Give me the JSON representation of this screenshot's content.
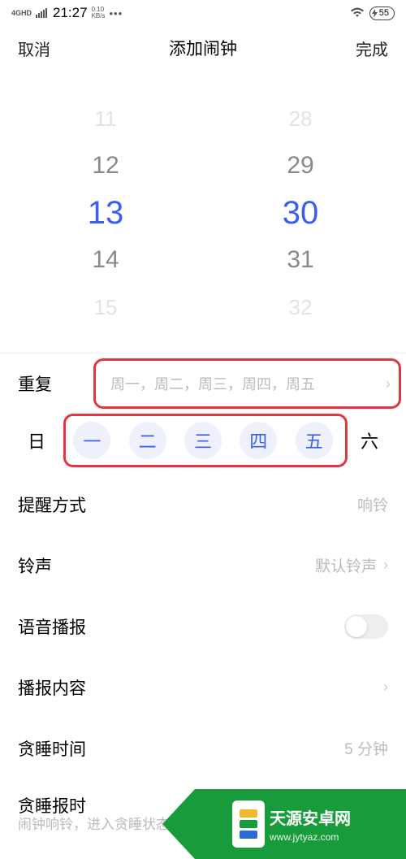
{
  "status": {
    "network_type": "4GHD",
    "time": "21:27",
    "data_rate_num": "0.10",
    "data_rate_unit": "KB/s",
    "battery": "55"
  },
  "header": {
    "cancel": "取消",
    "title": "添加闹钟",
    "done": "完成"
  },
  "picker": {
    "hours": [
      "11",
      "12",
      "13",
      "14",
      "15"
    ],
    "minutes": [
      "28",
      "29",
      "30",
      "31",
      "32"
    ]
  },
  "repeat": {
    "label": "重复",
    "value": "周一，周二，周三，周四，周五"
  },
  "days": {
    "items": [
      "日",
      "一",
      "二",
      "三",
      "四",
      "五",
      "六"
    ],
    "selected": [
      false,
      true,
      true,
      true,
      true,
      true,
      false
    ]
  },
  "alert_mode": {
    "label": "提醒方式",
    "value": "响铃"
  },
  "ringtone": {
    "label": "铃声",
    "value": "默认铃声"
  },
  "voice": {
    "label": "语音播报"
  },
  "voice_content": {
    "label": "播报内容"
  },
  "snooze": {
    "label": "贪睡时间",
    "value": "5 分钟"
  },
  "snooze_report": {
    "title": "贪睡报时",
    "subtitle": "闹钟响铃，进入贪睡状态后日"
  },
  "watermark": {
    "title": "天源安卓网",
    "url": "www.jytyaz.com"
  }
}
